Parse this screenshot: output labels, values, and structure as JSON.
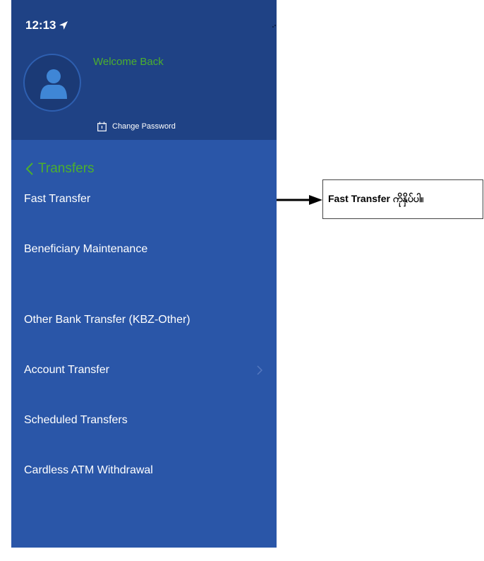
{
  "status_bar": {
    "time": "12:13"
  },
  "header": {
    "welcome": "Welcome Back",
    "change_password": "Change Password"
  },
  "nav": {
    "back_label": "Transfers"
  },
  "menu": {
    "items": [
      {
        "label": "Fast Transfer"
      },
      {
        "label": "Beneficiary Maintenance"
      },
      {
        "label": "Other Bank Transfer (KBZ-Other)"
      },
      {
        "label": "Account Transfer"
      },
      {
        "label": "Scheduled Transfers"
      },
      {
        "label": "Cardless ATM Withdrawal"
      }
    ]
  },
  "annotation": {
    "text": "Fast Transfer ကိုနှိပ်ပါ။"
  },
  "colors": {
    "header_bg": "#1f4285",
    "menu_bg": "#2a56a8",
    "accent_green": "#4caf2e",
    "text_white": "#ffffff"
  }
}
